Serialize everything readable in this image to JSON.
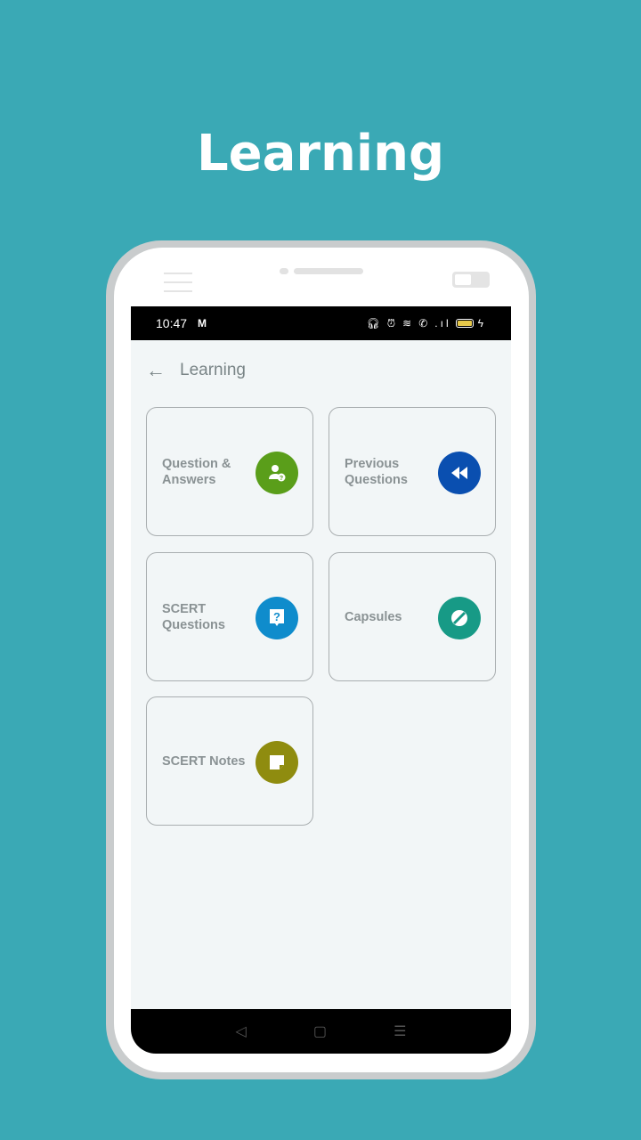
{
  "headline": "Learning",
  "status_bar": {
    "time": "10:47",
    "notification_icon": "M",
    "icons": [
      "headphones-icon",
      "alarm-icon",
      "wifi-icon",
      "call-icon",
      "signal-icon",
      "battery-icon",
      "charging-icon"
    ]
  },
  "app_bar": {
    "title": "Learning",
    "back_icon": "arrow-left-icon"
  },
  "cards": [
    {
      "label": "Question & Answers",
      "icon": "user-question-icon",
      "color": "#5a9e1a"
    },
    {
      "label": "Previous Questions",
      "icon": "rewind-icon",
      "color": "#0a4fb0"
    },
    {
      "label": "SCERT Questions",
      "icon": "question-bubble-icon",
      "color": "#0f8ccc"
    },
    {
      "label": "Capsules",
      "icon": "pill-icon",
      "color": "#179a86"
    },
    {
      "label": "SCERT Notes",
      "icon": "sticky-note-icon",
      "color": "#8f8c0f"
    }
  ],
  "nav": {
    "back": "◁",
    "home": "▢",
    "menu": "☰"
  }
}
